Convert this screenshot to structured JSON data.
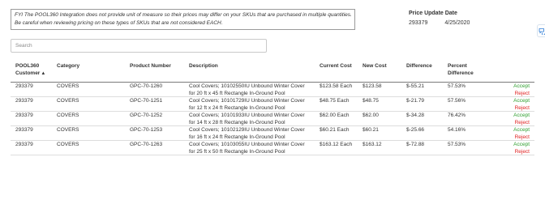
{
  "notice": {
    "line1": "FYI The POOL360 Integration does not provide unit of measure so their prices may differ on your SKUs that are purchased in multiple quantities.",
    "line2": "Be careful when reviewing pricing on these types of SKUs that are not considered EACH."
  },
  "price_update": {
    "title": "Price Update Date",
    "customer": "293379",
    "date": "4/25/2020"
  },
  "search": {
    "placeholder": "Search"
  },
  "table": {
    "headers": {
      "customer_line1": "POOL360",
      "customer_line2": "Customer",
      "sort_indicator": "▲",
      "category": "Category",
      "product_number": "Product Number",
      "description": "Description",
      "current_cost": "Current Cost",
      "new_cost": "New Cost",
      "difference": "Difference",
      "percent_line1": "Percent",
      "percent_line2": "Difference"
    },
    "rows": [
      {
        "customer": "293379",
        "category": "COVERS",
        "product_number": "GPC-70-1260",
        "description_line1": "Cool Covers; 10102550IU Unbound Winter Cover",
        "description_line2": "for 20 ft x 45 ft Rectangle In-Ground Pool",
        "current_cost": "$123.58 Each",
        "new_cost": "$123.58",
        "difference": "$-55.21",
        "percent": "57.53%",
        "accept": "Accept",
        "reject": "Reject"
      },
      {
        "customer": "293379",
        "category": "COVERS",
        "product_number": "GPC-70-1251",
        "description_line1": "Cool Covers; 10101729IU Unbound Winter Cover",
        "description_line2": "for 12 ft x 24 ft Rectangle In-Ground Pool",
        "current_cost": "$48.75 Each",
        "new_cost": "$48.75",
        "difference": "$-21.79",
        "percent": "57.56%",
        "accept": "Accept",
        "reject": "Reject"
      },
      {
        "customer": "293379",
        "category": "COVERS",
        "product_number": "GPC-70-1252",
        "description_line1": "Cool Covers; 10101933IU Unbound Winter Cover",
        "description_line2": "for 14 ft x 28 ft Rectangle In-Ground Pool",
        "current_cost": "$62.00 Each",
        "new_cost": "$62.00",
        "difference": "$-34.28",
        "percent": "76.42%",
        "accept": "Accept",
        "reject": "Reject"
      },
      {
        "customer": "293379",
        "category": "COVERS",
        "product_number": "GPC-70-1253",
        "description_line1": "Cool Covers; 10102129IU Unbound Winter Cover",
        "description_line2": "for 16 ft x 24 ft Rectangle In-Ground Pool",
        "current_cost": "$60.21 Each",
        "new_cost": "$60.21",
        "difference": "$-25.66",
        "percent": "54.16%",
        "accept": "Accept",
        "reject": "Reject"
      },
      {
        "customer": "293379",
        "category": "COVERS",
        "product_number": "GPC-70-1263",
        "description_line1": "Cool Covers; 10103055IU Unbound Winter Cover",
        "description_line2": "for 25 ft x 50 ft Rectangle In-Ground Pool",
        "current_cost": "$163.12 Each",
        "new_cost": "$163.12",
        "difference": "$-72.88",
        "percent": "57.53%",
        "accept": "Accept",
        "reject": "Reject"
      }
    ]
  },
  "icons": {
    "side_icon": "chat-refresh-icon"
  },
  "colors": {
    "accept": "#2e9e2e",
    "reject": "#e02020",
    "side_icon": "#2b7bd6"
  }
}
